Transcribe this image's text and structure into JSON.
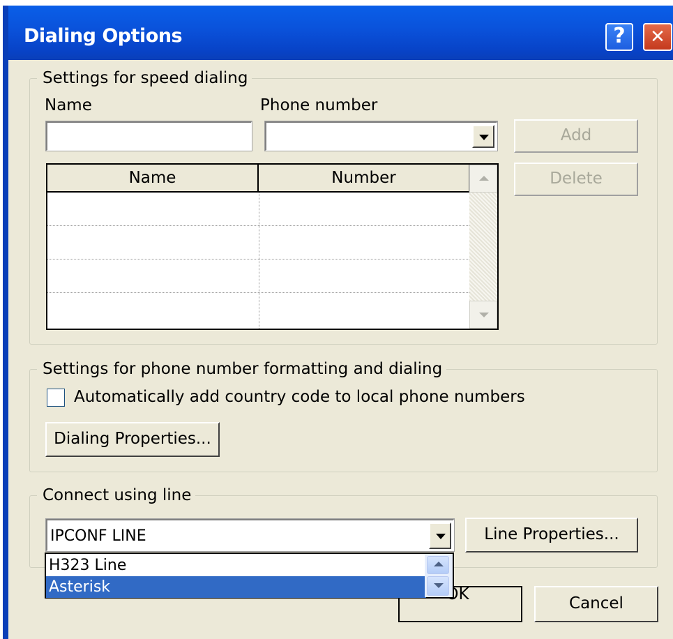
{
  "window": {
    "title": "Dialing Options",
    "help_glyph": "?",
    "close_glyph": "✕"
  },
  "speed_dial": {
    "group_title": "Settings for speed dialing",
    "name_label": "Name",
    "name_value": "",
    "phone_label": "Phone number",
    "phone_value": "",
    "add_label": "Add",
    "delete_label": "Delete",
    "columns": [
      "Name",
      "Number"
    ],
    "rows": [
      [
        "",
        ""
      ],
      [
        "",
        ""
      ],
      [
        "",
        ""
      ],
      [
        "",
        ""
      ]
    ]
  },
  "formatting": {
    "group_title": "Settings for phone number formatting and dialing",
    "auto_country_label": "Automatically add country code to local phone numbers",
    "auto_country_checked": false,
    "dialing_properties_label": "Dialing Properties..."
  },
  "line": {
    "group_title": "Connect using line",
    "selected": "IPCONF LINE",
    "options": [
      "H323 Line",
      "Asterisk"
    ],
    "highlighted_option": "Asterisk",
    "line_properties_label": "Line Properties..."
  },
  "footer": {
    "ok_label": "OK",
    "cancel_label": "Cancel"
  },
  "colors": {
    "titlebar": "#0a53dc",
    "face": "#ece9d8",
    "selection": "#316ac5"
  }
}
